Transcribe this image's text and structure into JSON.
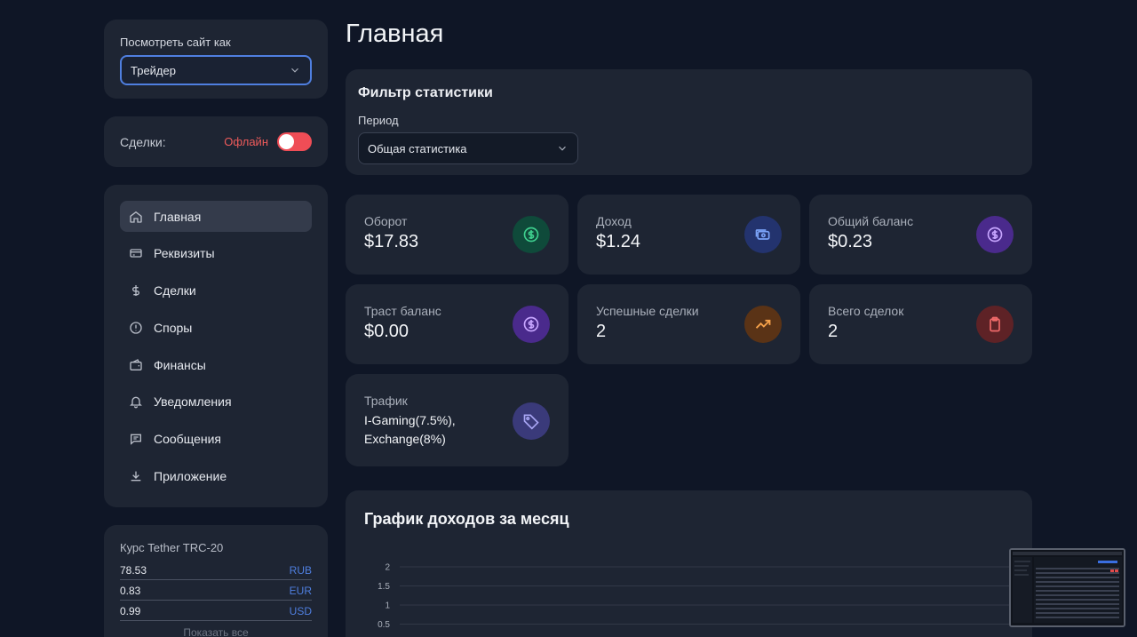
{
  "sidebar": {
    "view_as": {
      "label": "Посмотреть сайт как",
      "value": "Трейдер"
    },
    "deals": {
      "label": "Сделки:",
      "status": "Офлайн"
    },
    "nav": [
      {
        "label": "Главная",
        "icon": "home-icon"
      },
      {
        "label": "Реквизиты",
        "icon": "card-icon"
      },
      {
        "label": "Сделки",
        "icon": "dollar-icon"
      },
      {
        "label": "Споры",
        "icon": "alert-circle-icon"
      },
      {
        "label": "Финансы",
        "icon": "wallet-icon"
      },
      {
        "label": "Уведомления",
        "icon": "bell-icon"
      },
      {
        "label": "Сообщения",
        "icon": "message-icon"
      },
      {
        "label": "Приложение",
        "icon": "download-icon"
      }
    ],
    "rates": {
      "label": "Курс Tether TRC-20",
      "rows": [
        {
          "value": "78.53",
          "currency": "RUB"
        },
        {
          "value": "0.83",
          "currency": "EUR"
        },
        {
          "value": "0.99",
          "currency": "USD"
        }
      ],
      "show_all": "Показать все"
    }
  },
  "main": {
    "title": "Главная",
    "filter": {
      "heading": "Фильтр статистики",
      "period_label": "Период",
      "period_value": "Общая статистика"
    },
    "stats": [
      {
        "title": "Оборот",
        "value": "$17.83",
        "icon": "dollar-circle-icon",
        "color": "#0f4a3a",
        "icon_color": "#3ecf8e"
      },
      {
        "title": "Доход",
        "value": "$1.24",
        "icon": "cash-icon",
        "color": "#23336e",
        "icon_color": "#7aa2f7"
      },
      {
        "title": "Общий баланс",
        "value": "$0.23",
        "icon": "dollar-circle-icon",
        "color": "#4a2a8c",
        "icon_color": "#c7a6ff"
      },
      {
        "title": "Траст баланс",
        "value": "$0.00",
        "icon": "dollar-circle-icon",
        "color": "#4a2a8c",
        "icon_color": "#c7a6ff"
      },
      {
        "title": "Успешные сделки",
        "value": "2",
        "icon": "trend-up-icon",
        "color": "#5a3316",
        "icon_color": "#f5a14a"
      },
      {
        "title": "Всего сделок",
        "value": "2",
        "icon": "clipboard-icon",
        "color": "#5e2226",
        "icon_color": "#f06a6a"
      }
    ],
    "traffic": {
      "title": "Трафик",
      "value": "I-Gaming(7.5%), Exchange(8%)"
    },
    "chart": {
      "heading": "График доходов за месяц"
    }
  },
  "chart_data": {
    "type": "line",
    "title": "График доходов за месяц",
    "y_ticks": [
      "2",
      "1.5",
      "1",
      "0.5"
    ],
    "ylim": [
      0,
      2
    ],
    "grid": true,
    "series": []
  }
}
